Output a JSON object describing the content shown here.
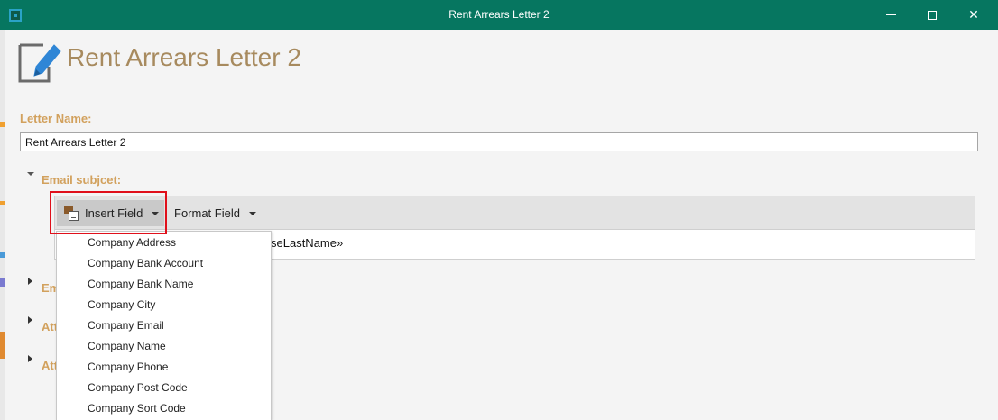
{
  "window": {
    "title": "Rent Arrears Letter 2",
    "minimize_glyph": "—",
    "close_glyph": "✕",
    "accent_color": "#067660"
  },
  "header": {
    "title": "Rent Arrears Letter 2",
    "icon": "edit-document-icon"
  },
  "letter_name": {
    "label": "Letter Name:",
    "value": "Rent Arrears Letter 2"
  },
  "email_subject": {
    "label": "Email subjcet:",
    "toolbar": {
      "insert_field": "Insert Field",
      "format_field": "Format Field"
    },
    "editor_text": "seLastName»"
  },
  "insert_field_menu": {
    "items": [
      "Company Address",
      "Company Bank Account",
      "Company Bank Name",
      "Company City",
      "Company Email",
      "Company Name",
      "Company Phone",
      "Company Post Code",
      "Company Sort Code"
    ]
  },
  "collapsed_sections": [
    "Em",
    "Att",
    "Att"
  ],
  "colors": {
    "label": "#d2a15d",
    "title": "#a78a5e",
    "highlight": "#e0101b"
  }
}
